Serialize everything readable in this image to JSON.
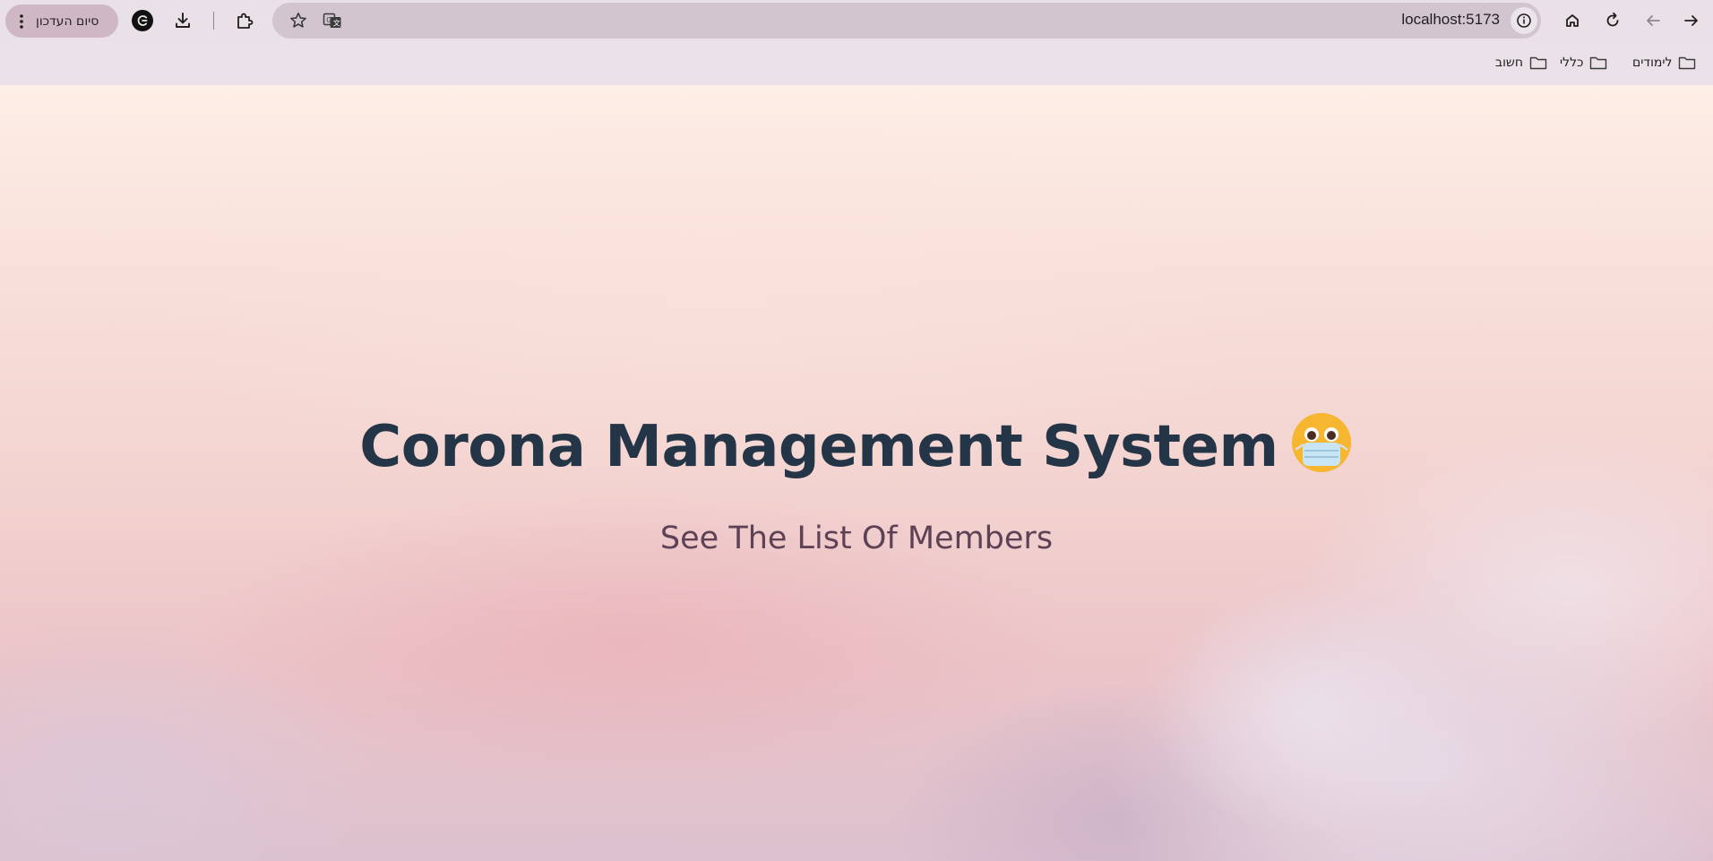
{
  "browser": {
    "url": "localhost:5173",
    "update_button_label": "סיום העדכון",
    "bookmarks": [
      {
        "label": "לימודים",
        "icon": "folder-icon"
      },
      {
        "label": "כללי",
        "icon": "folder-icon"
      },
      {
        "label": "חשוב",
        "icon": "folder-icon"
      }
    ]
  },
  "page": {
    "title": "Corona Management System",
    "title_emoji": "face-with-medical-mask-icon",
    "link_text": "See The List Of Members"
  },
  "colors": {
    "title": "#233546",
    "link": "#5d4255",
    "chrome": "#e9e0e8",
    "omnibox": "#d2c5cf"
  }
}
